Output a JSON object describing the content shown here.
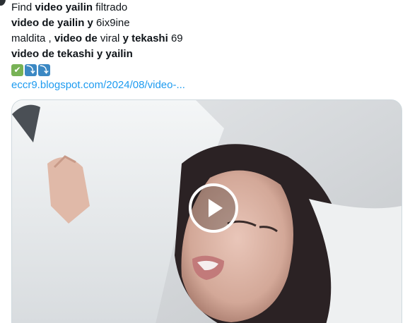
{
  "tweet": {
    "lines": [
      [
        {
          "t": "Find ",
          "b": false
        },
        {
          "t": "video yailin",
          "b": true
        },
        {
          "t": " filtrado",
          "b": false
        }
      ],
      [
        {
          "t": "video de yailin y",
          "b": true
        },
        {
          "t": " 6ix9ine",
          "b": false
        }
      ],
      [
        {
          "t": "maldita , ",
          "b": false
        },
        {
          "t": "video de",
          "b": true
        },
        {
          "t": " viral ",
          "b": false
        },
        {
          "t": "y tekashi",
          "b": true
        },
        {
          "t": " 69",
          "b": false
        }
      ],
      [
        {
          "t": "video de tekashi y yailin",
          "b": true
        }
      ]
    ],
    "emojis": {
      "check": "✔",
      "arrow1": "⤵",
      "arrow2": "⤵"
    },
    "link_text": "eccr9.blogspot.com/2024/08/video-..."
  },
  "colors": {
    "link": "#1d9bf0",
    "border": "#cfd9de",
    "check_emoji": "#77b255",
    "arrow_emoji": "#3b88c3"
  },
  "media": {
    "type": "video-thumbnail",
    "play_icon": "play-icon"
  }
}
